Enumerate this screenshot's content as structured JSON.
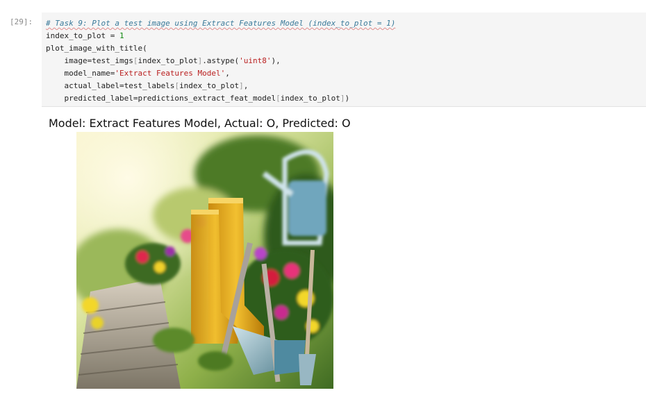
{
  "cell": {
    "prompt": "[29]:",
    "lines": {
      "comment": "# Task 9: Plot a test image using Extract Features Model (index_to_plot = 1)",
      "l2_var": "index_to_plot",
      "l2_op": " = ",
      "l2_num": "1",
      "l3": "plot_image_with_title(",
      "l4_pre": "    image=test_imgs",
      "l4_open": "[",
      "l4_mid": "index_to_plot",
      "l4_close": "]",
      "l4_post": ".astype(",
      "l4_str": "'uint8'",
      "l4_end": "),",
      "l5_pre": "    model_name=",
      "l5_str": "'Extract Features Model'",
      "l5_end": ",",
      "l6_pre": "    actual_label=test_labels",
      "l6_open": "[",
      "l6_mid": "index_to_plot",
      "l6_close": "]",
      "l6_end": ",",
      "l7_pre": "    predicted_label=predictions_extract_feat_model",
      "l7_open": "[",
      "l7_mid": "index_to_plot",
      "l7_close": "]",
      "l7_end": ")"
    }
  },
  "output": {
    "title": "Model: Extract Features Model, Actual: O, Predicted: O",
    "image_subject": "garden-boots-and-tools-photo"
  }
}
